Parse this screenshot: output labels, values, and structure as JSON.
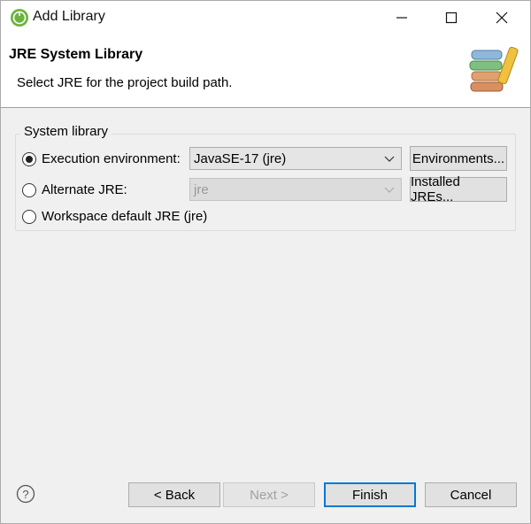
{
  "window": {
    "title": "Add Library"
  },
  "banner": {
    "title": "JRE System Library",
    "description": "Select JRE for the project build path."
  },
  "group": {
    "label": "System library",
    "options": [
      {
        "label": "Execution environment:",
        "selected": true
      },
      {
        "label": "Alternate JRE:",
        "selected": false
      },
      {
        "label": "Workspace default JRE (jre)",
        "selected": false
      }
    ],
    "exec_env_value": "JavaSE-17 (jre)",
    "alt_jre_value": "jre",
    "environments_button": "Environments...",
    "installed_jres_button": "Installed JREs..."
  },
  "footer": {
    "back": "< Back",
    "next": "Next >",
    "finish": "Finish",
    "cancel": "Cancel"
  },
  "colors": {
    "default_button_border": "#0078d7",
    "disabled_text": "#a0a0a0"
  }
}
